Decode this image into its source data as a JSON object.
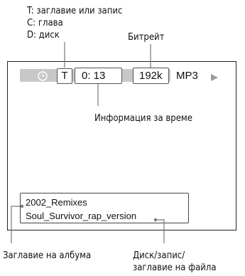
{
  "labels": {
    "track_type_t": "T: заглавие или запис",
    "track_type_c": "C: глава",
    "track_type_d": "D: диск",
    "bitrate": "Битрейт",
    "time_info": "Информация за време",
    "album_title": "Заглавие на албума",
    "file_title_line1": "Диск/запис/",
    "file_title_line2": "заглавие на файла"
  },
  "display": {
    "type_indicator": "T",
    "time": "0: 13",
    "bitrate_value": "192k",
    "format": "MP3",
    "album": "2002_Remixes",
    "file": "Soul_Survivor_rap_version"
  },
  "colors": {
    "bar": "#c8c8c8",
    "icon": "#ffffff",
    "play": "#9a9a9a"
  },
  "icons": {
    "clock": "clock-icon",
    "play": "play-icon"
  }
}
